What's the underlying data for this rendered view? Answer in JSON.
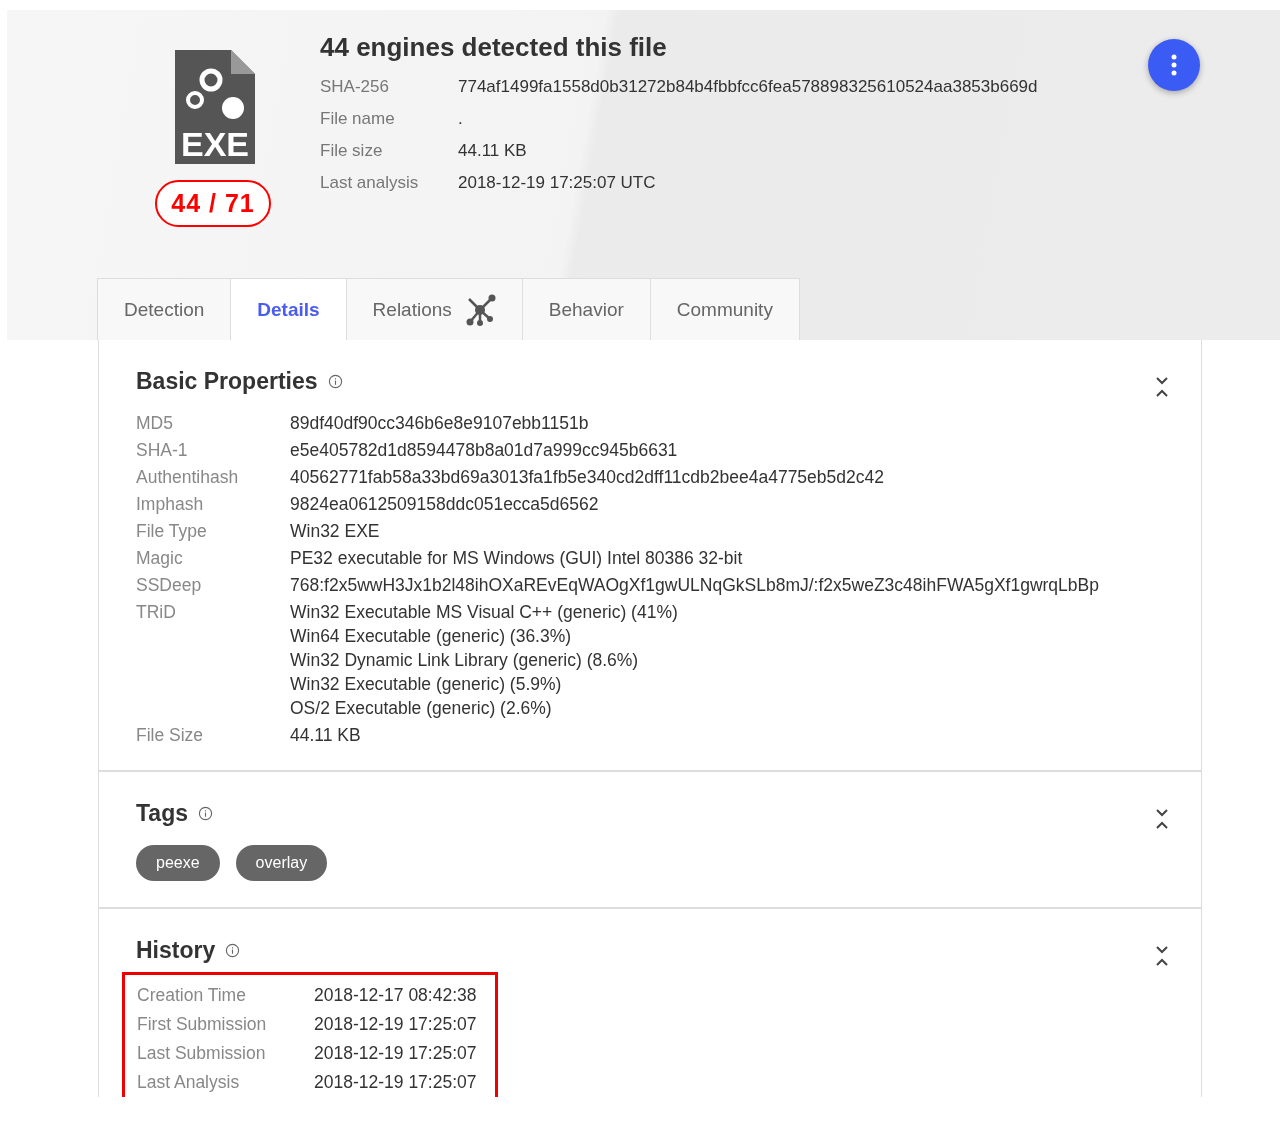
{
  "header": {
    "file_type_label": "EXE",
    "score": "44 / 71",
    "title": "44 engines detected this file",
    "fields": [
      {
        "label": "SHA-256",
        "value": "774af1499fa1558d0b31272b84b4fbbfcc6fea578898325610524aa3853b669d"
      },
      {
        "label": "File name",
        "value": "."
      },
      {
        "label": "File size",
        "value": "44.11 KB"
      },
      {
        "label": "Last analysis",
        "value": "2018-12-19 17:25:07 UTC"
      }
    ]
  },
  "tabs": [
    {
      "label": "Detection",
      "selected": false
    },
    {
      "label": "Details",
      "selected": true
    },
    {
      "label": "Relations",
      "selected": false,
      "kind": "graph"
    },
    {
      "label": "Behavior",
      "selected": false
    },
    {
      "label": "Community",
      "selected": false
    }
  ],
  "basic_properties": {
    "title": "Basic Properties",
    "rows": [
      {
        "label": "MD5",
        "values": [
          "89df40df90cc346b6e8e9107ebb1151b"
        ]
      },
      {
        "label": "SHA-1",
        "values": [
          "e5e405782d1d8594478b8a01d7a999cc945b6631"
        ]
      },
      {
        "label": "Authentihash",
        "values": [
          "40562771fab58a33bd69a3013fa1fb5e340cd2dff11cdb2bee4a4775eb5d2c42"
        ]
      },
      {
        "label": "Imphash",
        "values": [
          "9824ea0612509158ddc051ecca5d6562"
        ]
      },
      {
        "label": "File Type",
        "values": [
          "Win32 EXE"
        ]
      },
      {
        "label": "Magic",
        "values": [
          "PE32 executable for MS Windows (GUI) Intel 80386 32-bit"
        ]
      },
      {
        "label": "SSDeep",
        "values": [
          "768:f2x5wwH3Jx1b2l48ihOXaREvEqWAOgXf1gwULNqGkSLb8mJ/:f2x5weZ3c48ihFWA5gXf1gwrqLbBp"
        ]
      },
      {
        "label": "TRiD",
        "values": [
          "Win32 Executable MS Visual C++ (generic) (41%)",
          "Win64 Executable (generic) (36.3%)",
          "Win32 Dynamic Link Library (generic) (8.6%)",
          "Win32 Executable (generic) (5.9%)",
          "OS/2 Executable (generic) (2.6%)"
        ]
      },
      {
        "label": "File Size",
        "values": [
          "44.11 KB"
        ]
      }
    ]
  },
  "tags": {
    "title": "Tags",
    "items": [
      "peexe",
      "overlay"
    ]
  },
  "history": {
    "title": "History",
    "highlighted": true,
    "rows": [
      {
        "label": "Creation Time",
        "value": "2018-12-17 08:42:38"
      },
      {
        "label": "First Submission",
        "value": "2018-12-19 17:25:07"
      },
      {
        "label": "Last Submission",
        "value": "2018-12-19 17:25:07"
      },
      {
        "label": "Last Analysis",
        "value": "2018-12-19 17:25:07"
      }
    ]
  }
}
